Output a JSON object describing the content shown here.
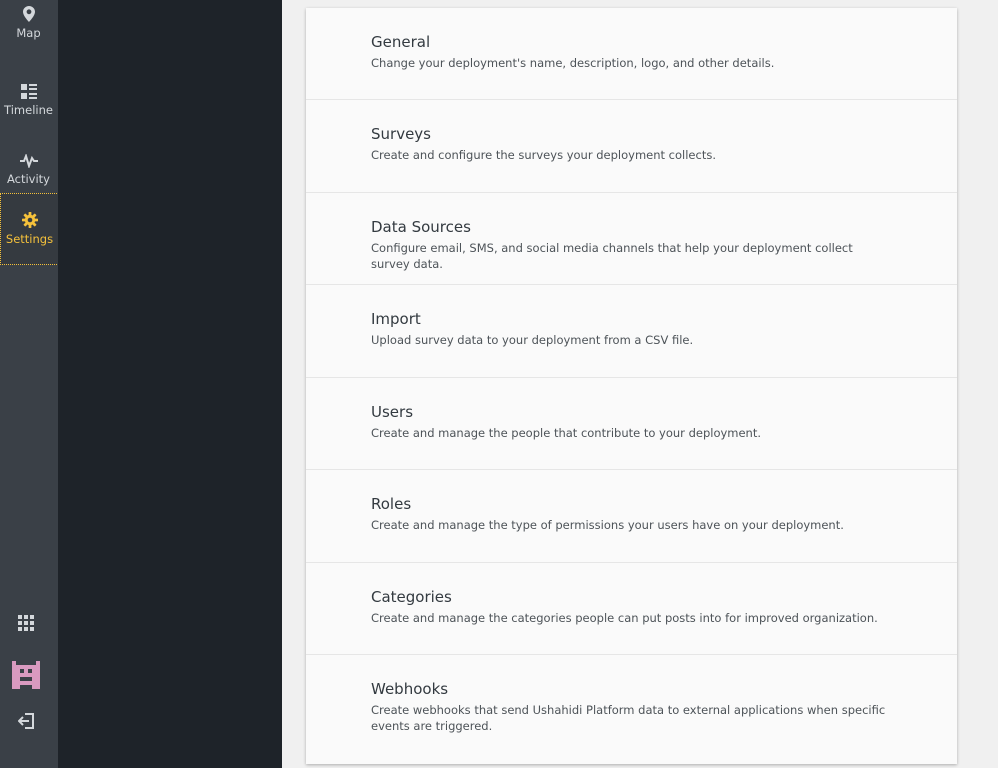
{
  "nav": {
    "items": [
      {
        "label": "Map",
        "icon": "map-pin-icon"
      },
      {
        "label": "Timeline",
        "icon": "timeline-icon"
      },
      {
        "label": "Activity",
        "icon": "activity-icon"
      },
      {
        "label": "Settings",
        "icon": "gear-icon",
        "active": true
      }
    ],
    "bottom": [
      {
        "icon": "apps-grid-icon"
      },
      {
        "icon": "user-avatar-icon"
      },
      {
        "icon": "logout-icon"
      }
    ],
    "active_color": "#f5c13b"
  },
  "settings": {
    "items": [
      {
        "title": "General",
        "description": "Change your deployment's name, description, logo, and other details."
      },
      {
        "title": "Surveys",
        "description": "Create and configure the surveys your deployment collects."
      },
      {
        "title": "Data Sources",
        "description": "Configure email, SMS, and social media channels that help your deployment collect survey data."
      },
      {
        "title": "Import",
        "description": "Upload survey data to your deployment from a CSV file."
      },
      {
        "title": "Users",
        "description": "Create and manage the people that contribute to your deployment."
      },
      {
        "title": "Roles",
        "description": "Create and manage the type of permissions your users have on your deployment."
      },
      {
        "title": "Categories",
        "description": "Create and manage the categories people can put posts into for improved organization."
      },
      {
        "title": "Webhooks",
        "description": "Create webhooks that send Ushahidi Platform data to external applications when specific events are triggered."
      }
    ]
  }
}
